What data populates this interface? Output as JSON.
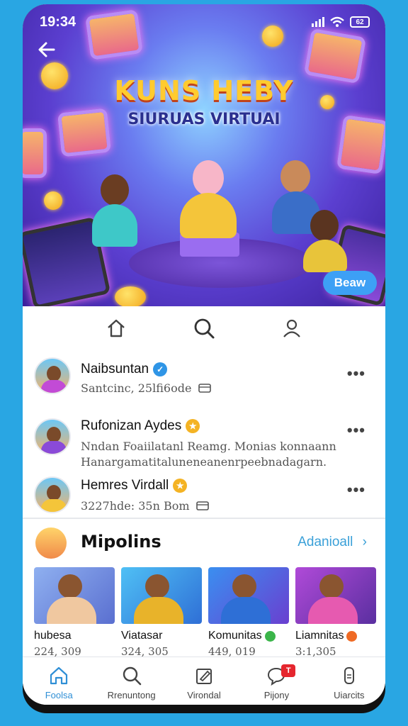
{
  "status": {
    "time": "19:34",
    "battery": "62"
  },
  "hero": {
    "title": "KUNS HEBY",
    "subtitle": "SIURUAS VIRTUAI",
    "action_label": "Beaw"
  },
  "top_nav": {
    "icons": [
      "home-icon",
      "search-icon",
      "profile-icon"
    ]
  },
  "users": [
    {
      "name": "Naibsuntan",
      "badge": "verified",
      "badge_color": "#2f95e6",
      "subtitle": "Santcinc, 25lfi6ode",
      "line2": ""
    },
    {
      "name": "Rufonizan Aydes",
      "badge": "star",
      "badge_color": "#f4b324",
      "subtitle": "Nndan Foaiilatanl Reamg. Monias konnaann",
      "line2": "Hanargamatitaluneneanenrpeebnadagarn."
    },
    {
      "name": "Hemres Virdall",
      "badge": "star",
      "badge_color": "#f4b324",
      "subtitle": "3227hde: 35n Bom",
      "line2": ""
    }
  ],
  "section": {
    "title": "Mipolins",
    "link": "Adanioall",
    "cards": [
      {
        "title": "hubesa",
        "count": "224, 309",
        "dot_color": "",
        "thumb_bg": "#6b8fd9",
        "shirt": "#f0c8a0"
      },
      {
        "title": "Viatasar",
        "count": "324, 305",
        "dot_color": "",
        "thumb_bg": "#2f9fe8",
        "shirt": "#e8b32a"
      },
      {
        "title": "Komunitas",
        "count": "449, 019",
        "dot_color": "#3bb54a",
        "thumb_bg": "#5b3fd0",
        "shirt": "#2e6fd6"
      },
      {
        "title": "Liamnitas",
        "count": "3:1,305",
        "dot_color": "#ef6a24",
        "thumb_bg": "#7a3fb8",
        "shirt": "#e65ab0"
      }
    ]
  },
  "bottom_nav": [
    {
      "label": "Foolsa",
      "icon": "home-icon",
      "active": true
    },
    {
      "label": "Rrenuntong",
      "icon": "search-icon",
      "active": false
    },
    {
      "label": "Virondal",
      "icon": "edit-icon",
      "active": false
    },
    {
      "label": "Pijony",
      "icon": "chat-icon",
      "active": false,
      "notif": "T"
    },
    {
      "label": "Uiarcits",
      "icon": "phone-icon",
      "active": false
    }
  ],
  "colors": {
    "accent": "#2f8fd6",
    "background": "#29a6e3",
    "link": "#3aa0d8"
  }
}
